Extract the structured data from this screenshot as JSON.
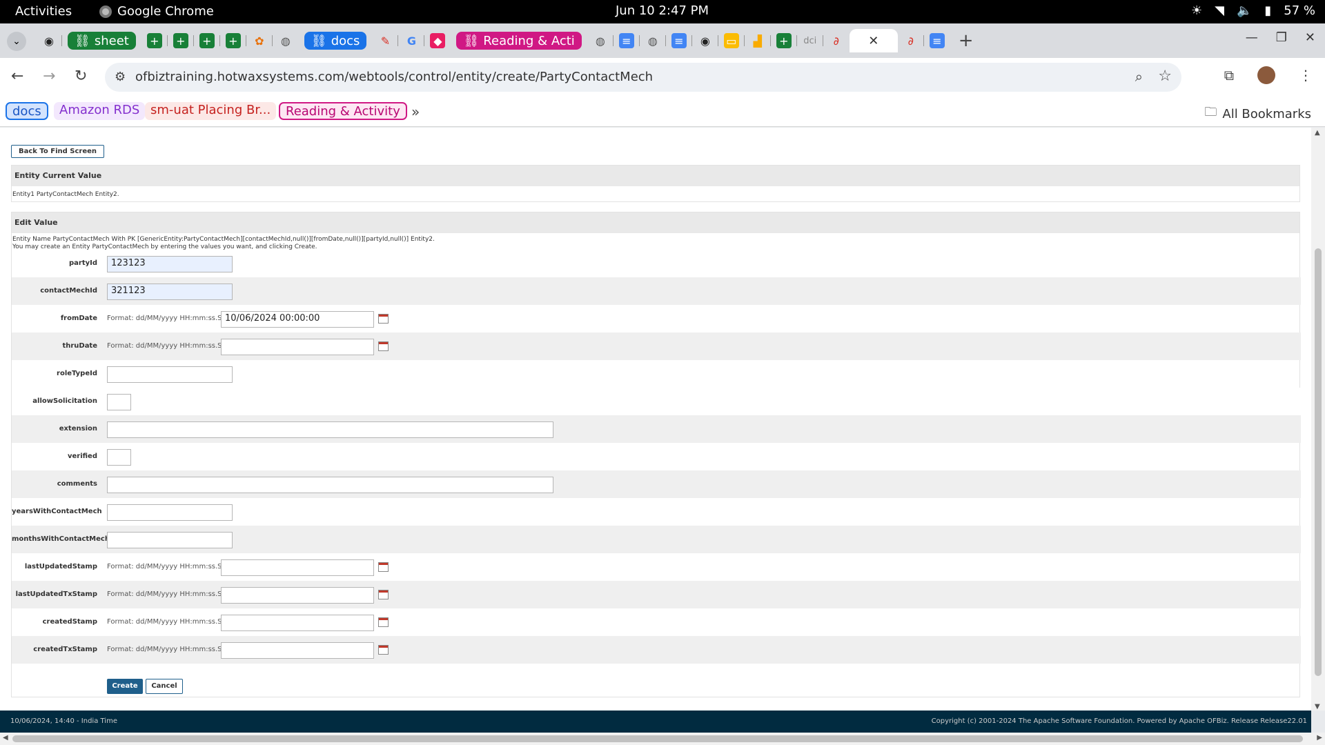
{
  "system": {
    "activities": "Activities",
    "app_name": "Google Chrome",
    "clock": "Jun 10  2:47 PM",
    "battery": "57 %"
  },
  "tabs": {
    "group_sheet": "sheet",
    "group_docs": "docs",
    "group_reading": "Reading & Acti",
    "new_tab": "+"
  },
  "toolbar": {
    "url": "ofbiztraining.hotwaxsystems.com/webtools/control/entity/create/PartyContactMech"
  },
  "bookmarks": {
    "docs": "docs",
    "rds": "Amazon RDS",
    "sm": "sm-uat Placing Br...",
    "reading": "Reading & Activity",
    "more": "»",
    "all": "All Bookmarks"
  },
  "page": {
    "back_button": "Back To Find Screen",
    "current_value_title": "Entity Current Value",
    "current_value_text": "Entity1 PartyContactMech Entity2.",
    "edit_title": "Edit Value",
    "edit_text_1": "Entity Name PartyContactMech With PK [GenericEntity:PartyContactMech][contactMechId,null()][fromDate,null()][partyId,null()] Entity2.",
    "edit_text_2": "You may create an Entity PartyContactMech by entering the values you want, and clicking Create.",
    "date_format": "Format: dd/MM/yyyy HH:mm:ss.SSS",
    "fields": {
      "partyId": {
        "label": "partyId",
        "value": "123123"
      },
      "contactMechId": {
        "label": "contactMechId",
        "value": "321123"
      },
      "fromDate": {
        "label": "fromDate",
        "value": "10/06/2024 00:00:00"
      },
      "thruDate": {
        "label": "thruDate",
        "value": ""
      },
      "roleTypeId": {
        "label": "roleTypeId",
        "value": ""
      },
      "allowSolicitation": {
        "label": "allowSolicitation",
        "value": ""
      },
      "extension": {
        "label": "extension",
        "value": ""
      },
      "verified": {
        "label": "verified",
        "value": ""
      },
      "comments": {
        "label": "comments",
        "value": ""
      },
      "yearsWithContactMech": {
        "label": "yearsWithContactMech",
        "value": ""
      },
      "monthsWithContactMech": {
        "label": "monthsWithContactMech",
        "value": ""
      },
      "lastUpdatedStamp": {
        "label": "lastUpdatedStamp",
        "value": ""
      },
      "lastUpdatedTxStamp": {
        "label": "lastUpdatedTxStamp",
        "value": ""
      },
      "createdStamp": {
        "label": "createdStamp",
        "value": ""
      },
      "createdTxStamp": {
        "label": "createdTxStamp",
        "value": ""
      }
    },
    "create_button": "Create",
    "cancel_button": "Cancel"
  },
  "footer": {
    "left": "10/06/2024, 14:40 - India Time",
    "right": "Copyright (c) 2001-2024 The Apache Software Foundation. Powered by Apache OFBiz. Release Release22.01"
  }
}
